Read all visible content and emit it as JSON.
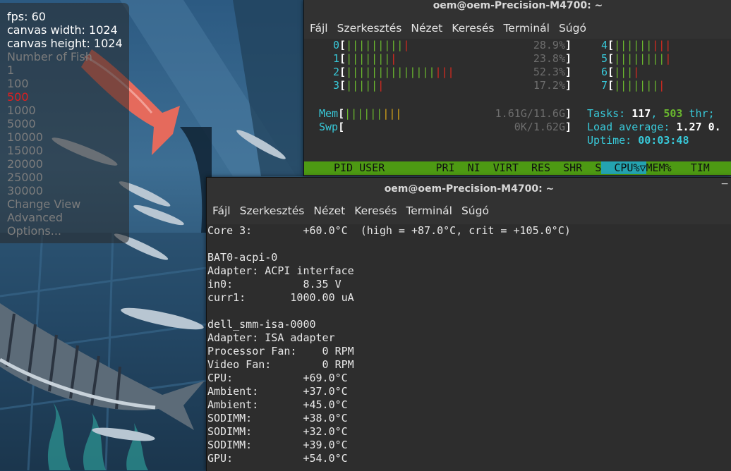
{
  "hud": {
    "stats": [
      "fps: 60",
      "canvas width: 1024",
      "canvas height: 1024"
    ],
    "options": [
      {
        "label": "Number of Fish",
        "active": false
      },
      {
        "label": "1",
        "active": false
      },
      {
        "label": "100",
        "active": false
      },
      {
        "label": "500",
        "active": true
      },
      {
        "label": "1000",
        "active": false
      },
      {
        "label": "5000",
        "active": false
      },
      {
        "label": "10000",
        "active": false
      },
      {
        "label": "15000",
        "active": false
      },
      {
        "label": "20000",
        "active": false
      },
      {
        "label": "25000",
        "active": false
      },
      {
        "label": "30000",
        "active": false
      },
      {
        "label": "Change View",
        "active": false
      },
      {
        "label": "Advanced",
        "active": false
      },
      {
        "label": "Options...",
        "active": false
      }
    ]
  },
  "htop_window": {
    "title": "oem@oem-Precision-M4700: ~",
    "menu": [
      "Fájl",
      "Szerkesztés",
      "Nézet",
      "Keresés",
      "Terminál",
      "Súgó"
    ],
    "cpus_left": [
      {
        "id": "0",
        "green": "|||||||||",
        "red": "|",
        "pct": "28.9%"
      },
      {
        "id": "1",
        "green": "|||||||",
        "red": "|",
        "pct": "23.8%"
      },
      {
        "id": "2",
        "green": "||||||||||||||",
        "red": "|||",
        "pct": "52.3%"
      },
      {
        "id": "3",
        "green": "|||||",
        "red": "|",
        "pct": "17.2%"
      }
    ],
    "cpus_right": [
      {
        "id": "4",
        "green": "||||||",
        "red": "|||"
      },
      {
        "id": "5",
        "green": "||||||||",
        "red": "|"
      },
      {
        "id": "6",
        "green": "|||",
        "red": "|"
      },
      {
        "id": "7",
        "green": "|||||||",
        "red": "|"
      }
    ],
    "mem": {
      "label": "Mem",
      "green": "||||||",
      "yellow": "|||",
      "value": "1.61G/11.6G"
    },
    "swp": {
      "label": "Swp",
      "value": "0K/1.62G"
    },
    "tasks_label": "Tasks:",
    "tasks_count": "117",
    "threads_count": "503",
    "threads_label": "thr;",
    "load_label": "Load average:",
    "load_value": "1.27 0.",
    "uptime_label": "Uptime:",
    "uptime_value": "00:03:48",
    "columns": [
      "PID",
      "USER",
      "PRI",
      "NI",
      "VIRT",
      "RES",
      "SHR",
      "S",
      "CPU%▽",
      "MEM%",
      "TIM"
    ]
  },
  "sensors_window": {
    "title": "oem@oem-Precision-M4700: ~",
    "close_glyph": "−",
    "menu": [
      "Fájl",
      "Szerkesztés",
      "Nézet",
      "Keresés",
      "Terminál",
      "Súgó"
    ],
    "lines": [
      "Core 3:        +60.0°C  (high = +87.0°C, crit = +105.0°C)",
      "",
      "BAT0-acpi-0",
      "Adapter: ACPI interface",
      "in0:           8.35 V",
      "curr1:       1000.00 uA",
      "",
      "dell_smm-isa-0000",
      "Adapter: ISA adapter",
      "Processor Fan:    0 RPM",
      "Video Fan:        0 RPM",
      "CPU:           +69.0°C",
      "Ambient:       +37.0°C",
      "Ambient:       +45.0°C",
      "SODIMM:        +38.0°C",
      "SODIMM:        +32.0°C",
      "SODIMM:        +39.0°C",
      "GPU:           +54.0°C"
    ]
  }
}
